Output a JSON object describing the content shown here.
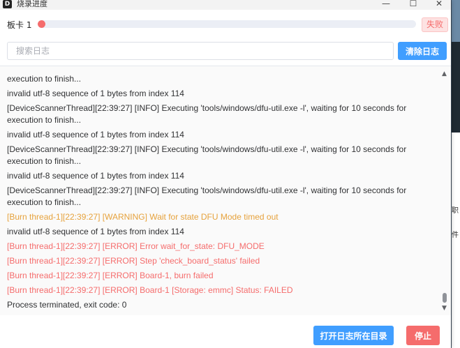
{
  "window": {
    "title": "烧录进度",
    "icon": "D",
    "minimize_glyph": "—",
    "maximize_glyph": "☐",
    "close_glyph": "✕"
  },
  "progress": {
    "board_label": "板卡 1",
    "fraction": 0.02,
    "fill_color": "#f56c6c",
    "status": "失败"
  },
  "search": {
    "placeholder": "搜索日志",
    "value": ""
  },
  "buttons": {
    "clear_log": "清除日志",
    "open_log_dir": "打开日志所在目录",
    "stop": "停止"
  },
  "colors": {
    "primary": "#409eff",
    "danger": "#f56c6c",
    "warning": "#e6a23c"
  },
  "logs": [
    {
      "level": "info",
      "text": "execution to finish..."
    },
    {
      "level": "info",
      "text": "invalid utf-8 sequence of 1 bytes from index 114"
    },
    {
      "level": "info",
      "text": "[DeviceScannerThread][22:39:27] [INFO] Executing 'tools/windows/dfu-util.exe -l', waiting for 10 seconds for execution to finish..."
    },
    {
      "level": "info",
      "text": "invalid utf-8 sequence of 1 bytes from index 114"
    },
    {
      "level": "info",
      "text": "[DeviceScannerThread][22:39:27] [INFO] Executing 'tools/windows/dfu-util.exe -l', waiting for 10 seconds for execution to finish..."
    },
    {
      "level": "info",
      "text": "invalid utf-8 sequence of 1 bytes from index 114"
    },
    {
      "level": "info",
      "text": "[DeviceScannerThread][22:39:27] [INFO] Executing 'tools/windows/dfu-util.exe -l', waiting for 10 seconds for execution to finish..."
    },
    {
      "level": "warning",
      "text": "[Burn thread-1][22:39:27] [WARNING] Wait for state DFU Mode timed out"
    },
    {
      "level": "info",
      "text": "invalid utf-8 sequence of 1 bytes from index 114"
    },
    {
      "level": "error",
      "text": "[Burn thread-1][22:39:27] [ERROR] Error wait_for_state: DFU_MODE"
    },
    {
      "level": "error",
      "text": "[Burn thread-1][22:39:27] [ERROR] Step 'check_board_status' failed"
    },
    {
      "level": "error",
      "text": "[Burn thread-1][22:39:27] [ERROR] Board-1, burn failed"
    },
    {
      "level": "error",
      "text": "[Burn thread-1][22:39:27] [ERROR] Board-1 [Storage: emmc] Status: FAILED"
    },
    {
      "level": "info",
      "text": "Process terminated, exit code: 0"
    }
  ],
  "scrollbar": {
    "up_glyph": "▲",
    "down_glyph": "▼"
  },
  "background_app": {
    "fragment_1": "职",
    "fragment_2": "件"
  }
}
